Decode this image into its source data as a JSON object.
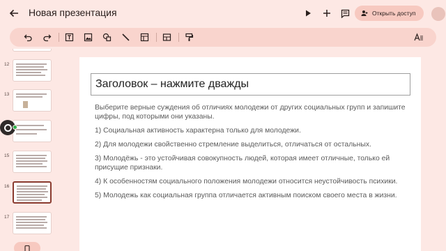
{
  "header": {
    "title": "Новая презентация",
    "share_label": "Открыть доступ",
    "icons": [
      "back-arrow-icon",
      "play-icon",
      "add-icon",
      "comments-icon",
      "person-add-icon"
    ]
  },
  "toolbar": {
    "icons": [
      "undo-icon",
      "redo-icon",
      "text-box-icon",
      "image-icon",
      "shapes-icon",
      "line-icon",
      "table-icon",
      "layout-icon",
      "paint-format-icon",
      "text-format-icon"
    ]
  },
  "filmstrip": {
    "thumbnails": [
      {
        "number": "12",
        "selected": false
      },
      {
        "number": "13",
        "selected": false
      },
      {
        "number": "14",
        "selected": false
      },
      {
        "number": "15",
        "selected": false
      },
      {
        "number": "16",
        "selected": true
      },
      {
        "number": "17",
        "selected": false
      }
    ]
  },
  "slide": {
    "title": "Заголовок – нажмите дважды",
    "paragraphs": [
      "Выберите верные суждения об отличиях молодежи от других социальных групп и запишите цифры, под которыми они указаны.",
      "1) Социальная активность характерна только для молодежи.",
      "2) Для молодежи свойственно стремление выделиться, отличаться от остальных.",
      "3) Молодёжь - это устойчивая совокупность людей, которая имеет отличные, только ей присущие признаки.",
      "4) К особенностям социального положения молодежи относится неустойчивость психики.",
      "5) Молодежь как социальная группа отличается активным поиском своего места в жизни."
    ]
  },
  "colors": {
    "background": "#fde8e4",
    "toolbar": "#f9d4cd",
    "accent_button": "#f7c9c0",
    "selected_border": "#8a3b2f"
  }
}
